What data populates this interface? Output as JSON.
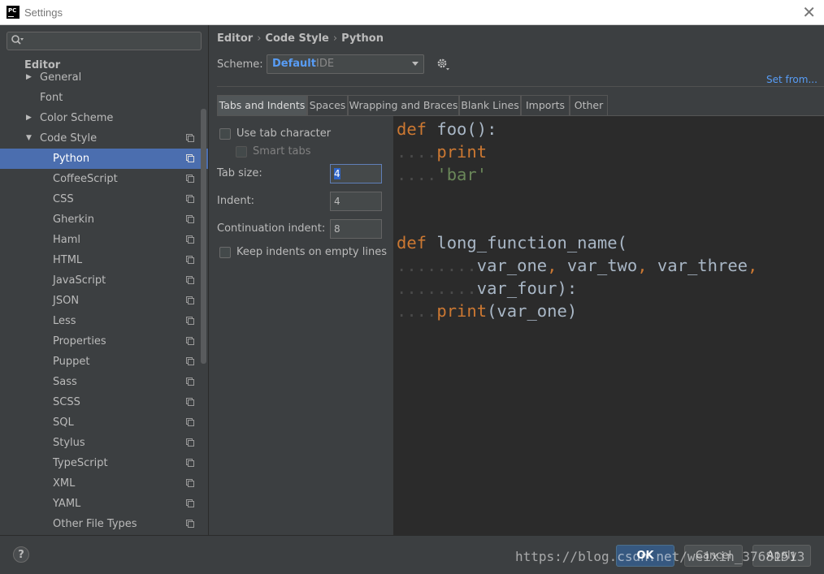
{
  "window": {
    "title": "Settings",
    "app_icon": "PC"
  },
  "search": {
    "placeholder": ""
  },
  "sidebar": {
    "section": "Editor",
    "items": [
      {
        "label": "General",
        "arrow": "▶"
      },
      {
        "label": "Font"
      },
      {
        "label": "Color Scheme",
        "arrow": "▶"
      },
      {
        "label": "Code Style",
        "arrow": "▼"
      },
      {
        "label": "Python"
      },
      {
        "label": "CoffeeScript"
      },
      {
        "label": "CSS"
      },
      {
        "label": "Gherkin"
      },
      {
        "label": "Haml"
      },
      {
        "label": "HTML"
      },
      {
        "label": "JavaScript"
      },
      {
        "label": "JSON"
      },
      {
        "label": "Less"
      },
      {
        "label": "Properties"
      },
      {
        "label": "Puppet"
      },
      {
        "label": "Sass"
      },
      {
        "label": "SCSS"
      },
      {
        "label": "SQL"
      },
      {
        "label": "Stylus"
      },
      {
        "label": "TypeScript"
      },
      {
        "label": "XML"
      },
      {
        "label": "YAML"
      },
      {
        "label": "Other File Types"
      }
    ]
  },
  "breadcrumb": [
    "Editor",
    "Code Style",
    "Python"
  ],
  "scheme": {
    "label": "Scheme:",
    "name": "Default",
    "sub": "IDE",
    "set_from": "Set from..."
  },
  "tabs": [
    "Tabs and Indents",
    "Spaces",
    "Wrapping and Braces",
    "Blank Lines",
    "Imports",
    "Other"
  ],
  "options": {
    "use_tab": "Use tab character",
    "smart_tabs": "Smart tabs",
    "tab_size_label": "Tab size:",
    "tab_size": "4",
    "indent_label": "Indent:",
    "indent": "4",
    "cont_label": "Continuation indent:",
    "cont": "8",
    "keep_indents": "Keep indents on empty lines"
  },
  "code": {
    "l1_kw": "def",
    "l1_rest": " foo():",
    "l2_dots": "....",
    "l2_kw": "print",
    "l3_dots": "....",
    "l3_str": "'bar'",
    "l4_kw": "def",
    "l4_rest": " long_function_name(",
    "l5_dots": "........",
    "l5_a": "var_one",
    "l5_c1": ",",
    "l5_b": " var_two",
    "l5_c2": ",",
    "l5_c": " var_three",
    "l5_c3": ",",
    "l6_dots": "........",
    "l6_rest": "var_four):",
    "l7_dots": "....",
    "l7_kw": "print",
    "l7_rest": "(var_one)"
  },
  "buttons": {
    "ok": "OK",
    "cancel": "Cancel",
    "apply": "Apply",
    "help": "?"
  },
  "watermark": "https://blog.csdn.net/weixin_37681513"
}
